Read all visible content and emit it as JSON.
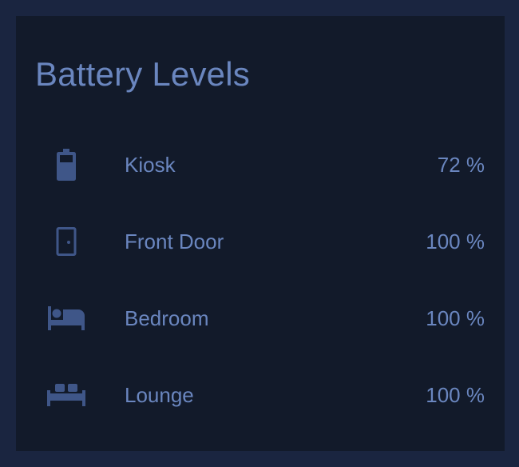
{
  "card": {
    "title": "Battery Levels"
  },
  "colors": {
    "background": "#1a2540",
    "card": "#121a2a",
    "text": "#6a86bf",
    "icon": "#3f5688"
  },
  "entities": [
    {
      "icon": "battery-icon",
      "name": "Kiosk",
      "value": "72 %",
      "level": 0.72
    },
    {
      "icon": "door-icon",
      "name": "Front Door",
      "value": "100 %",
      "level": 1.0
    },
    {
      "icon": "bed-icon",
      "name": "Bedroom",
      "value": "100 %",
      "level": 1.0
    },
    {
      "icon": "sofa-icon",
      "name": "Lounge",
      "value": "100 %",
      "level": 1.0
    }
  ]
}
